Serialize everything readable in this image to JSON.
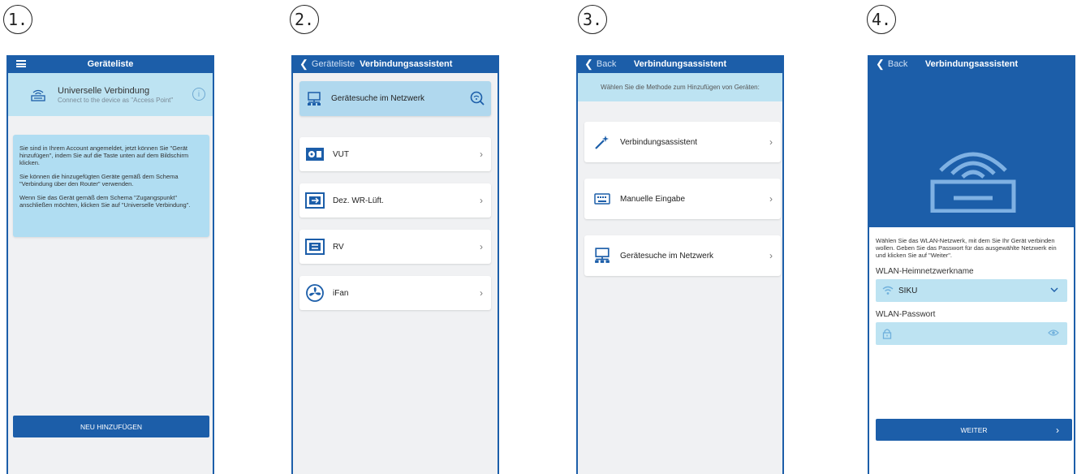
{
  "steps": [
    "1.",
    "2.",
    "3.",
    "4."
  ],
  "colors": {
    "primary": "#1c5ea9",
    "light_blue": "#bde3f2",
    "card_blue": "#b0d8ee"
  },
  "screen1": {
    "nav_title": "Geräteliste",
    "universal_title": "Universelle Verbindung",
    "universal_subtitle": "Connect to the device as \"Access Point\"",
    "message": [
      "Sie sind in Ihrem Account angemeldet, jetzt können Sie \"Gerät hinzufügen\", indem Sie auf die Taste unten auf dem Bildschirm klicken.",
      "Sie können die hinzugefügten Geräte gemäß dem Schema \"Verbindung über den Router\" verwenden.",
      "Wenn Sie das Gerät gemäß dem Schema \"Zugangspunkt\" anschließen möchten, klicken Sie auf \"Universelle Verbindung\"."
    ],
    "add_button": "NEU HINZUFÜGEN"
  },
  "screen2": {
    "back_label": "Geräteliste",
    "nav_title": "Verbindungsassistent",
    "search_label": "Gerätesuche im Netzwerk",
    "devices": [
      {
        "label": "VUT",
        "icon": "vut-unit-icon"
      },
      {
        "label": "Dez. WR-Lüft.",
        "icon": "decentral-unit-icon"
      },
      {
        "label": "RV",
        "icon": "rv-unit-icon"
      },
      {
        "label": "iFan",
        "icon": "fan-icon"
      }
    ]
  },
  "screen3": {
    "back_label": "Back",
    "nav_title": "Verbindungsassistent",
    "hint": "Wählen Sie die Methode zum Hinzufügen von Geräten:",
    "methods": [
      {
        "label": "Verbindungsassistent",
        "icon": "magic-wand-icon"
      },
      {
        "label": "Manuelle Eingabe",
        "icon": "keyboard-icon"
      },
      {
        "label": "Gerätesuche im Netzwerk",
        "icon": "network-icon"
      }
    ]
  },
  "screen4": {
    "back_label": "Back",
    "nav_title": "Verbindungsassistent",
    "description": "Wählen Sie das WLAN-Netzwerk, mit dem Sie Ihr Gerät verbinden wollen. Geben Sie das Passwort für das ausgewählte Netzwerk ein und klicken Sie auf \"Weiter\".",
    "ssid_label": "WLAN-Heimnetzwerkname",
    "ssid_value": "SIKU",
    "password_label": "WLAN-Passwort",
    "password_value": "",
    "next_button": "WEITER"
  }
}
